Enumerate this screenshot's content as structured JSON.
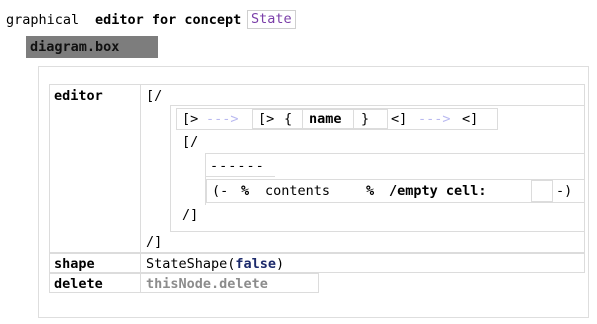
{
  "header": {
    "prefix": "graphical",
    "editor_kw": "editor for concept",
    "concept": "State"
  },
  "root": {
    "label": "diagram.box"
  },
  "editor_section": {
    "label": "editor",
    "vbox_open": "[/",
    "row1": {
      "open1": "[>",
      "arrow1": "--->",
      "open2": "[>",
      "lbrace": "{",
      "prop": "name",
      "rbrace": "}",
      "close2": "<]",
      "arrow2": "--->",
      "close1": "<]"
    },
    "inner_vbox_open": "[/",
    "separator": "------",
    "collection": {
      "open": "(-",
      "pct1": "%",
      "link": "contents",
      "pct2": "%",
      "empty": "/empty cell:",
      "close": "-)"
    },
    "inner_vbox_close": "/]",
    "vbox_close": "/]"
  },
  "shape_section": {
    "label": "shape",
    "value": "StateShape(",
    "arg": "false",
    "close": ")"
  },
  "delete_section": {
    "label": "delete",
    "value": "thisNode.delete"
  }
}
